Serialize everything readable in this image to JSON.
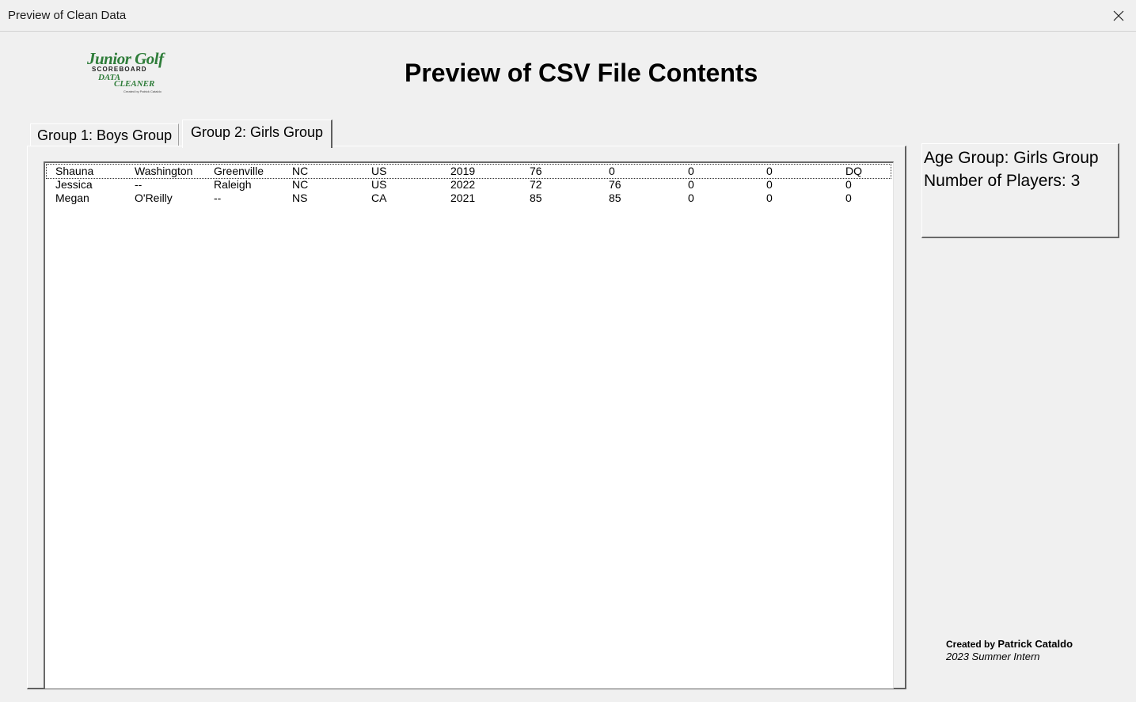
{
  "window": {
    "title": "Preview of Clean Data",
    "close_icon": "close-icon"
  },
  "logo": {
    "line1": "Junior Golf",
    "line2": "SCOREBOARD",
    "line3": "DATA",
    "line4": "CLEANER",
    "line5": "Created by Patrick Cataldo",
    "color": "#2f7d3a"
  },
  "heading": "Preview of CSV File Contents",
  "tabs": [
    {
      "label": "Group 1: Boys Group",
      "selected": false
    },
    {
      "label": "Group 2:  Girls Group",
      "selected": true
    }
  ],
  "rows": [
    [
      "Shauna",
      "Washington",
      "Greenville",
      "NC",
      "US",
      "2019",
      "76",
      "0",
      "0",
      "0",
      "DQ"
    ],
    [
      "Jessica",
      "--",
      "Raleigh",
      "NC",
      "US",
      "2022",
      "72",
      "76",
      "0",
      "0",
      "0"
    ],
    [
      "Megan",
      "O'Reilly",
      "--",
      "NS",
      "CA",
      "2021",
      "85",
      "85",
      "0",
      "0",
      "0"
    ]
  ],
  "info": {
    "age_group": "Age Group:  Girls Group",
    "players": "Number of Players: 3"
  },
  "credit": {
    "prefix": "Created by",
    "name": "Patrick Cataldo",
    "role": "2023 Summer Intern"
  }
}
